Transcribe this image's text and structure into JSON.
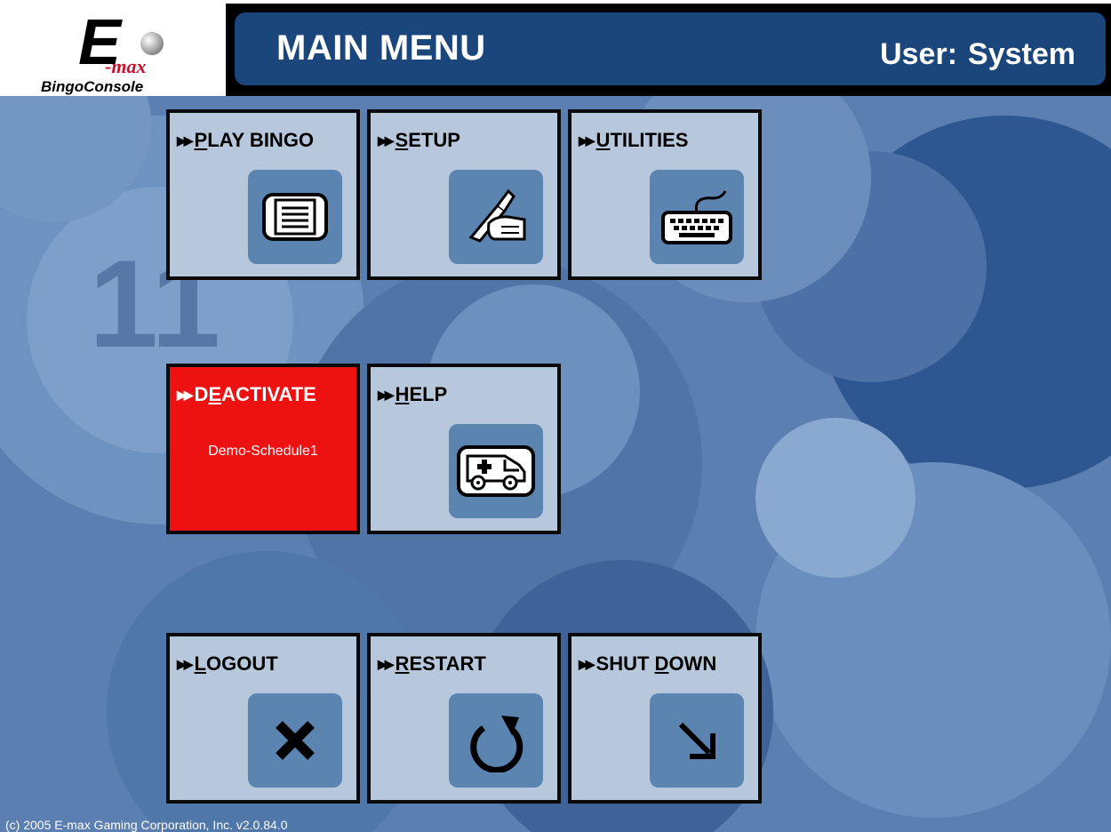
{
  "header": {
    "logo": {
      "main": "E",
      "tag": "-max",
      "sub": "BingoConsole"
    },
    "title": "MAIN MENU",
    "user_label": "User:",
    "user_name": "System"
  },
  "tiles": {
    "play_bingo": {
      "pre": "",
      "u": "P",
      "post": "LAY BINGO",
      "icon": "bingo-card-icon"
    },
    "setup": {
      "pre": "",
      "u": "S",
      "post": "ETUP",
      "icon": "pen-hand-icon"
    },
    "utilities": {
      "pre": "",
      "u": "U",
      "post": "TILITIES",
      "icon": "keyboard-icon"
    },
    "deactivate": {
      "pre": "D",
      "u": "E",
      "post": "ACTIVATE",
      "sub": "Demo-Schedule1",
      "color": "#ee1111"
    },
    "help": {
      "pre": "",
      "u": "H",
      "post": "ELP",
      "icon": "ambulance-icon"
    },
    "logout": {
      "pre": "",
      "u": "L",
      "post": "OGOUT",
      "icon": "x-icon"
    },
    "restart": {
      "pre": "",
      "u": "R",
      "post": "ESTART",
      "icon": "restart-arrow-icon"
    },
    "shutdown": {
      "pre": "SHUT ",
      "u": "D",
      "post": "OWN",
      "icon": "down-right-arrow-icon"
    }
  },
  "arrow_glyph": "▶▶",
  "footer": {
    "copyright": "(c) 2005 E-max Gaming Corporation, Inc. v2.0.84.0"
  },
  "colors": {
    "title_bar": "#1a467c",
    "tile": "#b8c8dc",
    "icon_box": "#5c84b1",
    "deactivate": "#ee1111"
  }
}
